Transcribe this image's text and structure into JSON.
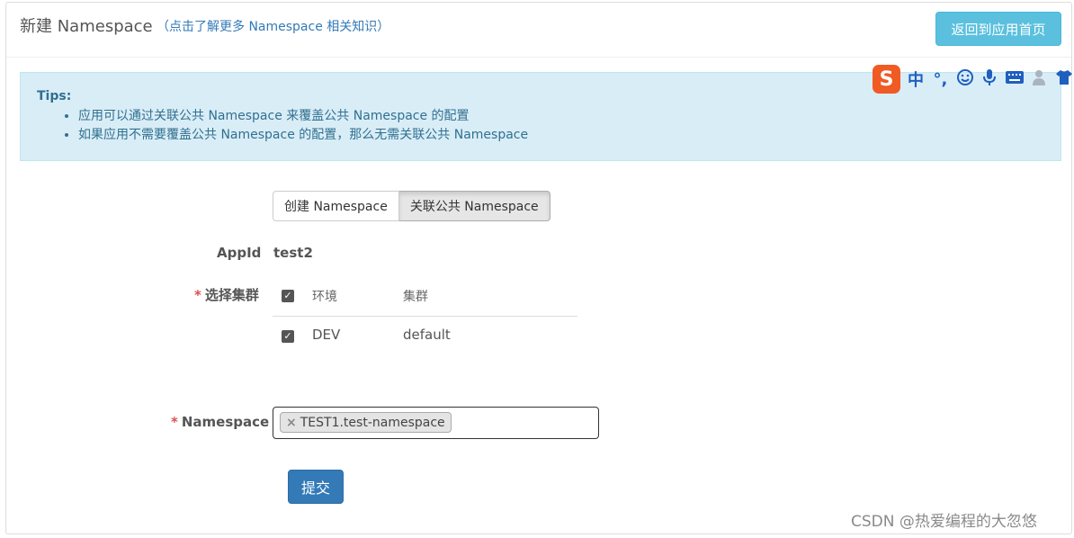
{
  "header": {
    "title": "新建 Namespace",
    "subtitle": "（点击了解更多 Namespace 相关知识）",
    "back_button": "返回到应用首页"
  },
  "tips": {
    "title": "Tips:",
    "items": [
      "应用可以通过关联公共 Namespace 来覆盖公共 Namespace 的配置",
      "如果应用不需要覆盖公共 Namespace 的配置，那么无需关联公共 Namespace"
    ]
  },
  "ime": {
    "logo": "S",
    "mode": "中",
    "punct": "°,",
    "icons": [
      "smiley-icon",
      "microphone-icon",
      "keyboard-icon",
      "user-icon",
      "shirt-icon"
    ]
  },
  "form": {
    "tabs": {
      "create": "创建 Namespace",
      "associate": "关联公共 Namespace",
      "active": "associate"
    },
    "appid_label": "AppId",
    "appid_value": "test2",
    "cluster_required": "*",
    "cluster_label": "选择集群",
    "cluster_table": {
      "headers": {
        "env": "环境",
        "cluster": "集群"
      },
      "rows": [
        {
          "env": "DEV",
          "cluster": "default",
          "checked": true
        }
      ],
      "header_checked": true
    },
    "namespace_required": "*",
    "namespace_label": "Namespace",
    "namespace_chip_remove": "×",
    "namespace_chip": "TEST1.test-namespace",
    "submit": "提交"
  },
  "watermark": "CSDN @热爱编程的大忽悠",
  "colors": {
    "info": "#5bc0de",
    "primary": "#337ab7",
    "tips_bg": "#d9edf7",
    "required": "#d9534f"
  }
}
